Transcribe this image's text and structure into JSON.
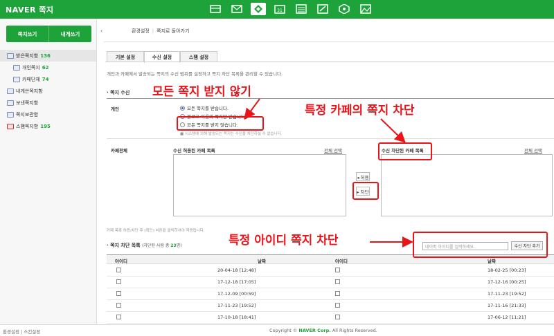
{
  "header": {
    "logo": "NAVER 쪽지",
    "icons": [
      "mail-box-icon",
      "envelope-icon",
      "note-icon",
      "calendar-icon",
      "list-icon",
      "edit-icon",
      "cafe-icon",
      "photo-icon"
    ]
  },
  "sidebar": {
    "write_label": "쪽지쓰기",
    "to_me_label": "내게쓰기",
    "items": [
      {
        "label": "받은쪽지함",
        "count": "136"
      },
      {
        "label": "개인쪽지",
        "count": "62"
      },
      {
        "label": "카페단체",
        "count": "74"
      },
      {
        "label": "내게쓴쪽지함",
        "count": ""
      },
      {
        "label": "보낸쪽지함",
        "count": ""
      },
      {
        "label": "쪽지보관함",
        "count": ""
      },
      {
        "label": "스팸쪽지함",
        "count": "195"
      }
    ],
    "collapse": "‹"
  },
  "breadcrumb": {
    "current": "환경설정",
    "back": "쪽지로 돌아가기"
  },
  "tabs": [
    "기본 설정",
    "수신 설정",
    "스팸 설정"
  ],
  "description": "개인과 카페에서 발송되는 쪽지의 수신 범위를 설정하고 쪽지 차단 목록을 관리할 수 있습니다.",
  "receive": {
    "title": "쪽지 수신",
    "personal_label": "개인",
    "options": [
      "모든 쪽지를 받습니다.",
      "블로그 이웃의 쪽지만 받습니다.",
      "모든 쪽지를 받지 않습니다."
    ],
    "note": "■ 시스템에 의해 발송되는 쪽지는 수신을 차단하실 수 없습니다.",
    "cafe_label": "카페전체",
    "allowed_title": "수신 허용된 카페 목록",
    "blocked_title": "수신 차단된 카페 목록",
    "select_all": "전체 선택",
    "allow_btn": "◂ 허용",
    "block_btn": "▸ 차단",
    "cafe_note": "카페 목록 허용/차단 후 [확인] 버튼을 클릭하셔야 적용됩니다."
  },
  "block_list": {
    "title": "쪽지 차단 목록",
    "sub_prefix": "(차단된 사람 총 ",
    "count": "23",
    "sub_suffix": "명)",
    "placeholder": "네이버 아이디를 입력하세요.",
    "add_btn": "수신 차단 추가",
    "col_id": "아이디",
    "col_date": "날짜",
    "rows": [
      {
        "left_date": "20-04-18 [12:48]",
        "right_date": "18-02-25 [00:23]"
      },
      {
        "left_date": "17-12-18 [17:05]",
        "right_date": "17-12-16 [00:25]"
      },
      {
        "left_date": "17-12-09 [00:59]",
        "right_date": "17-11-23 [19:52]"
      },
      {
        "left_date": "17-11-23 [19:52]",
        "right_date": "17-11-16 [21:33]"
      },
      {
        "left_date": "17-10-18 [18:41]",
        "right_date": "17-06-12 [11:21]"
      }
    ]
  },
  "footer": {
    "settings": "환경설정",
    "skin": "스킨설정",
    "copyright_prefix": "Copyright © ",
    "company": "NAVER Corp.",
    "copyright_suffix": " All Rights Reserved."
  },
  "annotations": {
    "a1": "모든 쪽지 받지 않기",
    "a2": "특정 카페의 쪽지 차단",
    "a3": "특정 아이디 쪽지 차단"
  },
  "colors": {
    "brand": "#1ea23a",
    "annotation": "#e8141a"
  }
}
